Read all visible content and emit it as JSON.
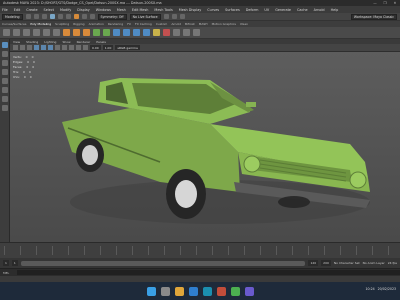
{
  "window": {
    "title": "Autodesk MAYA 2023: D:/SHORT/GTS/Dodge_CS_Opel/Datsun-200SX.ma  ---  Datsun-200SX.ma",
    "controls": [
      "—",
      "❐",
      "✕"
    ]
  },
  "menubar": [
    "File",
    "Edit",
    "Create",
    "Select",
    "Modify",
    "Display",
    "Windows",
    "Mesh",
    "Edit Mesh",
    "Mesh Tools",
    "Mesh Display",
    "Curves",
    "Surfaces",
    "Deform",
    "UV",
    "Generate",
    "Cache",
    "Arnold",
    "Help"
  ],
  "status": {
    "menuset": "Modeling",
    "live_surface": "No Live Surface",
    "symmetry": "Symmetry: Off",
    "workspace": "Workspace: Maya Classic"
  },
  "shelf_tabs": [
    "Curves/Surfaces",
    "Poly Modeling",
    "Sculpting",
    "Rigging",
    "Animation",
    "Rendering",
    "FX",
    "FX Caching",
    "Custom",
    "Arnold",
    "Bifrost",
    "MASH",
    "Motion Graphics",
    "XGen"
  ],
  "shelf_active": "Poly Modeling",
  "viewport": {
    "menu": [
      "View",
      "Shading",
      "Lighting",
      "Show",
      "Renderer",
      "Panels"
    ],
    "camera_field": "sRGB gamma",
    "value_a": "0.00",
    "value_b": "1.00",
    "hud": [
      {
        "label": "Verts:",
        "a": "0",
        "b": "0"
      },
      {
        "label": "Edges:",
        "a": "0",
        "b": "0"
      },
      {
        "label": "Faces:",
        "a": "0",
        "b": "0"
      },
      {
        "label": "Tris:",
        "a": "0",
        "b": "0"
      },
      {
        "label": "UVs:",
        "a": "0",
        "b": "0"
      }
    ],
    "car_color": "#8fbd52"
  },
  "range": {
    "start": "1",
    "start_inner": "1",
    "end_inner": "120",
    "end": "200",
    "no_character": "No Character Set",
    "no_anim_layer": "No Anim Layer",
    "fps": "24 fps"
  },
  "cmdline": {
    "label": "MEL"
  },
  "taskbar": {
    "time": "10:24",
    "date": "20/02/2023"
  }
}
